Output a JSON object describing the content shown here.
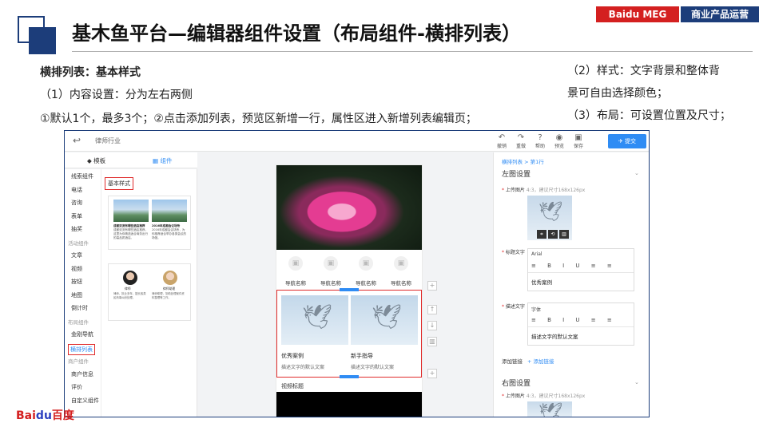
{
  "header": {
    "title": "基木鱼平台—编辑器组件设置（布局组件-横排列表）",
    "tag_left": "Baidu MEG",
    "tag_right": "商业产品运营部"
  },
  "description": {
    "heading": "横排列表：基本样式",
    "line1": "（1）内容设置：分为左右两侧",
    "line2": "①默认1个，最多3个；②点击添加列表，预览区新增一行，属性区进入新增列表编辑页；",
    "right1": "（2）样式：文字背景和整体背",
    "right2": "景可自由选择颜色；",
    "right3": "（3）布局：可设置位置及尺寸；"
  },
  "editor": {
    "topbar_title": "律师行业",
    "toolbar": [
      {
        "label": "撤销",
        "icon": "undo-icon",
        "glyph": "↶"
      },
      {
        "label": "重做",
        "icon": "redo-icon",
        "glyph": "↷"
      },
      {
        "label": "帮助",
        "icon": "help-icon",
        "glyph": "?"
      },
      {
        "label": "预览",
        "icon": "preview-icon",
        "glyph": "◉"
      },
      {
        "label": "保存",
        "icon": "save-icon",
        "glyph": "▣"
      }
    ],
    "submit_label": "提交",
    "tab_template": "模板",
    "tab_component": "组件",
    "component_list": [
      {
        "label": "线索组件",
        "type": "item"
      },
      {
        "label": "电话",
        "type": "item"
      },
      {
        "label": "咨询",
        "type": "item"
      },
      {
        "label": "表单",
        "type": "item"
      },
      {
        "label": "抽奖",
        "type": "item"
      },
      {
        "label": "活动组件",
        "type": "group"
      },
      {
        "label": "文章",
        "type": "item"
      },
      {
        "label": "视频",
        "type": "item"
      },
      {
        "label": "按钮",
        "type": "item"
      },
      {
        "label": "地图",
        "type": "item"
      },
      {
        "label": "倒计时",
        "type": "item"
      },
      {
        "label": "布局组件",
        "type": "group"
      },
      {
        "label": "金刚导航",
        "type": "item"
      },
      {
        "label": "横排列表",
        "type": "active"
      },
      {
        "label": "商户组件",
        "type": "group"
      },
      {
        "label": "商户信息",
        "type": "item"
      },
      {
        "label": "评价",
        "type": "item"
      },
      {
        "label": "自定义组件",
        "type": "item"
      }
    ],
    "style_label": "基本样式",
    "card1": {
      "left_title": "成都双流有哪些酒店推荐",
      "left_text": "成都双流有哪些酒店推荐，这里为你精选适合商务出行的高品质酒店。",
      "right_title": "2016年成都会议场所",
      "right_text": "2016年成都会议场所，为你推荐适合举办各类会议的场馆。"
    },
    "card2": {
      "left_name": "律师",
      "left_text": "律师，执业多年，擅长各类民商事纠纷处理。",
      "right_name": "律师助理",
      "right_text": "律师助理，协助处理案件资料整理等工作。"
    },
    "nav_items": [
      "导航名称",
      "导航名称",
      "导航名称",
      "导航名称"
    ],
    "list_items": [
      {
        "title": "优秀案例",
        "desc": "描述文字的默认文案"
      },
      {
        "title": "新手指导",
        "desc": "描述文字的默认文案"
      }
    ],
    "video_title": "视频标题",
    "props": {
      "breadcrumb": "横排列表  >  第1行",
      "left_section": "左图设置",
      "upload_label": "上传图片",
      "upload_hint": "4:3，建议尺寸168x126px",
      "title_label": "标题文字",
      "title_font": "Arial",
      "title_value": "优秀案例",
      "desc_label": "描述文字",
      "desc_font": "字体",
      "desc_value": "描述文字的默认文案",
      "link_label": "添加链接",
      "link_action": "+ 添加链接",
      "right_section": "右图设置"
    }
  },
  "footer": {
    "brand_a": "Bai",
    "brand_b": "du",
    "brand_c": "百度"
  }
}
